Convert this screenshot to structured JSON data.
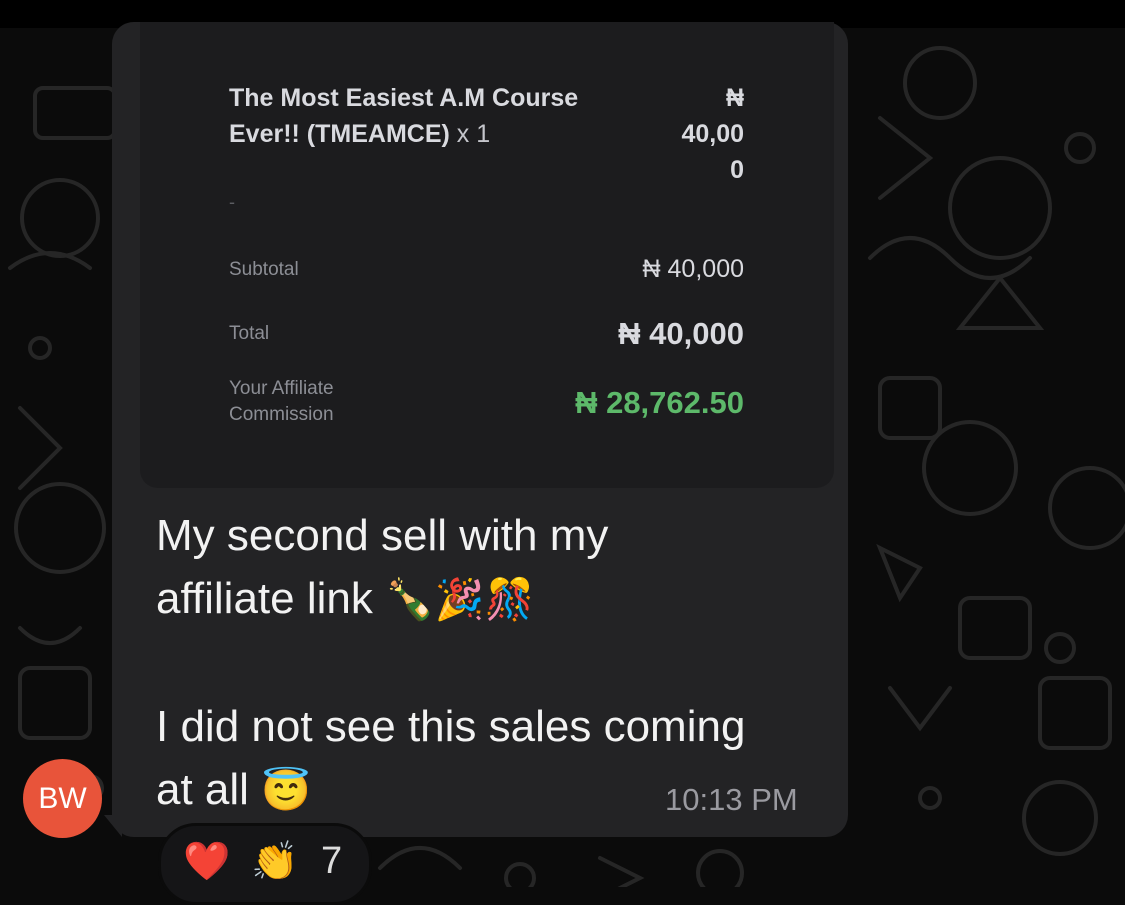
{
  "receipt": {
    "product_name": "The Most Easiest A.M Course Ever!! (TMEAMCE)",
    "quantity": "x 1",
    "price_line1": "₦",
    "price_line2": "40,00",
    "price_line3": "0",
    "separator": "-",
    "subtotal_label": "Subtotal",
    "subtotal_value": "₦ 40,000",
    "total_label": "Total",
    "total_value": "₦ 40,000",
    "commission_label_line1": "Your Affiliate",
    "commission_label_line2": "Commission",
    "commission_value": "₦ 28,762.50"
  },
  "message": {
    "line1": "My second sell with my",
    "line2": "affiliate link",
    "emojis": "🍾🎉🎊",
    "line3": "I did not see this sales coming",
    "line4": "at all",
    "emoji_end": "😇",
    "timestamp": "10:13 PM"
  },
  "sender": {
    "initials": "BW"
  },
  "reactions": {
    "heart": "❤️",
    "clap": "👏",
    "count": "7"
  },
  "colors": {
    "bubble": "#232325",
    "receipt_bg": "#1c1c1e",
    "commission_green": "#5db96a",
    "avatar": "#e8543a"
  }
}
